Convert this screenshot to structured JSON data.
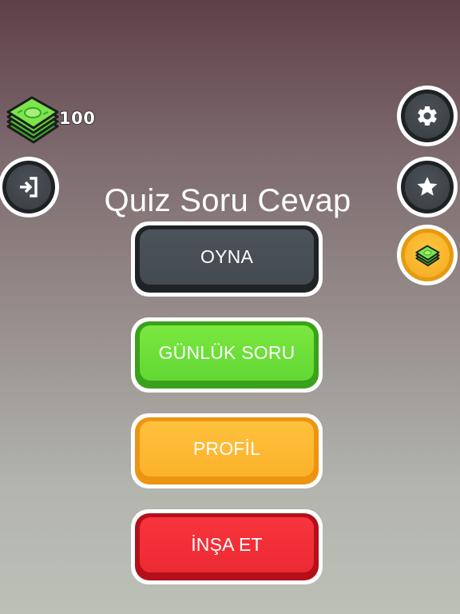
{
  "hud": {
    "money_icon": "cash-stack-icon",
    "money_count": "100"
  },
  "side_buttons": {
    "exit_icon": "exit-arrow-icon",
    "settings_icon": "gear-icon",
    "favorites_icon": "star-icon",
    "shop_icon": "cash-icon"
  },
  "title": "Quiz Soru Cevap",
  "menu": {
    "play_label": "OYNA",
    "daily_label": "GÜNLÜK SORU",
    "profile_label": "PROFİL",
    "build_label": "İNŞA ET"
  },
  "colors": {
    "play": "#434a50",
    "daily": "#62d733",
    "profile": "#fcb22b",
    "build": "#ec2a33",
    "round_dark": "#3e4348",
    "round_gold": "#f7b22a"
  }
}
